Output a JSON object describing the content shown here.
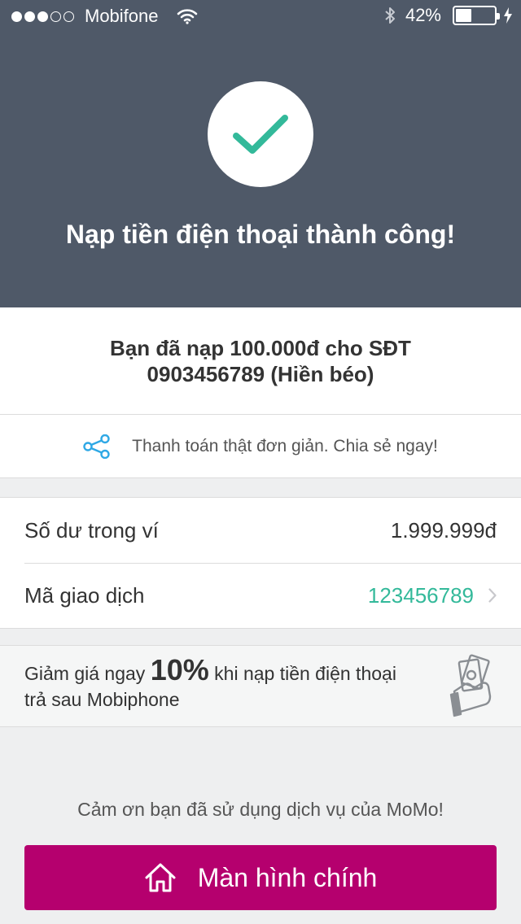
{
  "status_bar": {
    "carrier": "Mobifone",
    "battery_percent_text": "42%",
    "battery_level": 0.42,
    "signal_filled": 3,
    "signal_total": 5
  },
  "hero": {
    "title": "Nạp tiền điện thoại thành công!",
    "icon": "checkmark-icon",
    "background_color": "#4f5968",
    "check_color": "#33b99a"
  },
  "summary": {
    "line1": "Bạn đã nạp 100.000đ cho SĐT",
    "line2": "0903456789 (Hiền béo)"
  },
  "share": {
    "icon": "share-icon",
    "text": "Thanh toán thật đơn giản. Chia sẻ ngay!",
    "icon_color": "#2ea8e5"
  },
  "info": {
    "balance_label": "Số dư trong ví",
    "balance_value": "1.999.999đ",
    "transaction_label": "Mã giao dịch",
    "transaction_value": "123456789"
  },
  "promo": {
    "prefix": "Giảm giá ngay",
    "highlight": "10%",
    "suffix": "khi nạp tiền điện thoại",
    "line2": "trả sau Mobiphone",
    "icon": "money-hand-icon"
  },
  "footer": {
    "thanks": "Cảm ơn bạn đã sử dụng dịch vụ của MoMo!",
    "button_label": "Màn hình chính",
    "button_icon": "home-icon",
    "button_color": "#b5006e"
  }
}
